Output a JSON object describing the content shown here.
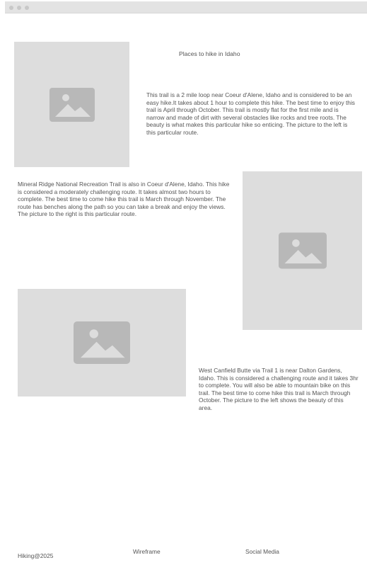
{
  "page": {
    "heading": "Places to hike in Idaho"
  },
  "sections": [
    {
      "text": "This trail is a 2 mile loop near Coeur d'Alene, Idaho and is considered to be an easy hike.It takes about 1 hour to complete this hike. The best time to enjoy this trail is April through October.  This trail is mostly flat for the first mile and is narrow and made of dirt with several obstacles like rocks and tree roots. The beauty is what makes this particular hike so enticing. The picture to the left is this particular route."
    },
    {
      "text": "Mineral Ridge National Recreation Trail is also in Coeur d'Alene, Idaho.  This hike is considered a moderately challenging route.  It takes almost two hours to complete.  The best time to come hike this trail is March through November.  The route  has benches along the path so you can take a break and enjoy the views. The picture to the right is this particular route."
    },
    {
      "text": "West Canfield Butte via Trail 1 is near Dalton Gardens, Idaho.  This is considered a challenging route and it takes 3hr to complete.  You will also be able to mountain bike on this trail.  The best time to come hike this trail is March through October. The picture to the left shows the beauty of this area."
    }
  ],
  "footer": {
    "copyright": "Hiking@2025",
    "wireframe": "Wireframe",
    "social": "Social Media"
  },
  "icons": {
    "placeholder": "image-placeholder-icon"
  },
  "colors": {
    "placeholder_bg": "#dddddd",
    "placeholder_icon": "#b5b5b5",
    "text": "#555555"
  }
}
